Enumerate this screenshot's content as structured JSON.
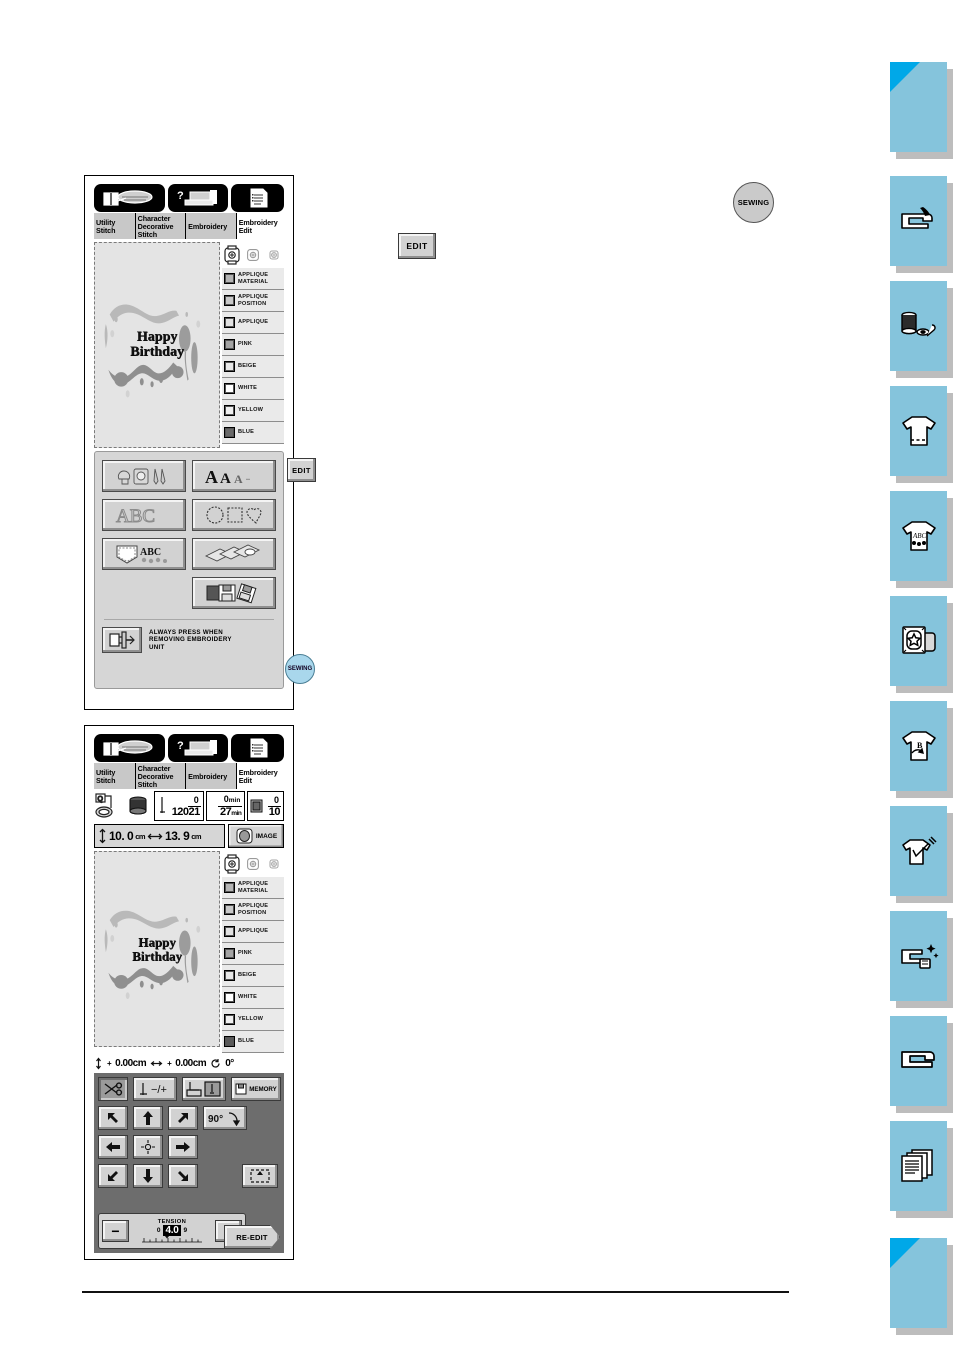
{
  "machine_ui": {
    "top_tabs": [
      {
        "name": "manual-book-icon",
        "label": ""
      },
      {
        "name": "help-machine-icon",
        "label": ""
      },
      {
        "name": "settings-list-icon",
        "label": ""
      }
    ],
    "mode_tabs": [
      {
        "id": "utility",
        "label": "Utility Stitch",
        "line1": "Utility",
        "line2": "Stitch",
        "active": false
      },
      {
        "id": "character",
        "label": "Character Decorative Stitch",
        "line1": "Character",
        "line2": "Decorative",
        "line3": "Stitch",
        "active": false
      },
      {
        "id": "embroidery",
        "label": "Embroidery",
        "line1": "Embroidery",
        "active": false
      },
      {
        "id": "embroidery_edit",
        "label": "Embroidery Edit",
        "line1": "Embroidery",
        "line2": "Edit",
        "active": true
      }
    ]
  },
  "screen1": {
    "design": {
      "text_line1": "Happy",
      "text_line2": "Birthday"
    },
    "hoop_buttons": [
      "hoop-large",
      "hoop-medium",
      "hoop-small"
    ],
    "color_list": [
      {
        "label": "APPLIQUE MATERIAL",
        "line1": "APPLIQUE",
        "line2": "MATERIAL",
        "swatch": "#b4b4b4"
      },
      {
        "label": "APPLIQUE POSITION",
        "line1": "APPLIQUE",
        "line2": "POSITION",
        "swatch": "#c9c9c9"
      },
      {
        "label": "APPLIQUE",
        "line1": "APPLIQUE",
        "line2": "",
        "swatch": "#e2e2e2"
      },
      {
        "label": "PINK",
        "line1": "PINK",
        "line2": "",
        "swatch": "#a3a3a3"
      },
      {
        "label": "BEIGE",
        "line1": "BEIGE",
        "line2": "",
        "swatch": "#e8e8e8"
      },
      {
        "label": "WHITE",
        "line1": "WHITE",
        "line2": "",
        "swatch": "#ffffff"
      },
      {
        "label": "YELLOW",
        "line1": "YELLOW",
        "line2": "",
        "swatch": "#f0f0f0"
      },
      {
        "label": "BLUE",
        "line1": "BLUE",
        "line2": "",
        "swatch": "#6a6a6a"
      }
    ],
    "selection_buttons": [
      {
        "name": "embroidery-patterns-button",
        "icon": "flower-frame-scissors-icon"
      },
      {
        "name": "alphabet-sizes-button",
        "icon": "AAA-letters-icon"
      },
      {
        "name": "abc-font-button",
        "icon": "ABC-outline-icon"
      },
      {
        "name": "frame-shapes-button",
        "icon": "circle-square-heart-icon"
      },
      {
        "name": "pocket-monogram-button",
        "icon": "pocket-ABC-icon"
      },
      {
        "name": "card-designs-button",
        "icon": "embroidery-cards-icon"
      },
      {
        "name": "memory-card-button",
        "icon": "floppy-disk-card-icon"
      }
    ],
    "footer_note": {
      "line1": "ALWAYS PRESS WHEN",
      "line2": "REMOVING EMBROIDERY",
      "line3": "UNIT"
    },
    "edit_button_label": "EDIT",
    "sewing_button_label": "SEWING"
  },
  "screen2": {
    "stats": {
      "presser_foot_icon": "embroidery-foot-icon",
      "bobbin_icon": "bobbin-icon",
      "stitch_count_current": "0",
      "stitch_count_total": "12021",
      "time_elapsed": "0",
      "time_elapsed_unit": "min",
      "time_total": "27",
      "time_total_unit": "min",
      "color_current": "0",
      "color_total": "10"
    },
    "size": {
      "height_value": "10. 0",
      "height_unit": "cm",
      "width_value": "13. 9",
      "width_unit": "cm",
      "image_button_label": "IMAGE"
    },
    "design": {
      "text_line1": "Happy",
      "text_line2": "Birthday"
    },
    "color_list": [
      {
        "label": "APPLIQUE MATERIAL",
        "line1": "APPLIQUE",
        "line2": "MATERIAL",
        "swatch": "#b4b4b4"
      },
      {
        "label": "APPLIQUE POSITION",
        "line1": "APPLIQUE",
        "line2": "POSITION",
        "swatch": "#c9c9c9"
      },
      {
        "label": "APPLIQUE",
        "line1": "APPLIQUE",
        "line2": "",
        "swatch": "#e2e2e2"
      },
      {
        "label": "PINK",
        "line1": "PINK",
        "line2": "",
        "swatch": "#a3a3a3"
      },
      {
        "label": "BEIGE",
        "line1": "BEIGE",
        "line2": "",
        "swatch": "#e8e8e8"
      },
      {
        "label": "WHITE",
        "line1": "WHITE",
        "line2": "",
        "swatch": "#ffffff"
      },
      {
        "label": "YELLOW",
        "line1": "YELLOW",
        "line2": "",
        "swatch": "#f0f0f0"
      },
      {
        "label": "BLUE",
        "line1": "BLUE",
        "line2": "",
        "swatch": "#5a5a5a"
      }
    ],
    "offsets": {
      "vertical_value": "0.00cm",
      "horizontal_value": "0.00cm",
      "rotation_value": "0°"
    },
    "controls": {
      "thread_cut_button": "scissors-icon",
      "needle_updown_button": "needle-plus-minus-icon",
      "start_point_button": "start-point-icon",
      "memory_button_label": "MEMORY",
      "rotate_button_label": "90°",
      "trial_button": "trial-frame-icon",
      "arrows": [
        "up-left",
        "up",
        "up-right",
        "left",
        "center",
        "right",
        "down-left",
        "down",
        "down-right"
      ]
    },
    "tension": {
      "label": "TENSION",
      "value": "4.0",
      "min": "0",
      "max": "9",
      "minus": "−",
      "plus": "+"
    },
    "reedit_button_label": "RE-EDIT"
  },
  "callouts": {
    "edit_label": "EDIT",
    "sewing_label": "SEWING"
  },
  "sidebar": {
    "accent_color": "#85c4dc",
    "corner_color": "#00a8e8",
    "items": [
      {
        "name": "sidebar-tab-cover",
        "icon": "blank-corner-icon"
      },
      {
        "name": "sidebar-tab-machine-overview",
        "icon": "sewing-machine-icon"
      },
      {
        "name": "sidebar-tab-thread-accessories",
        "icon": "thread-spool-bobbin-icon"
      },
      {
        "name": "sidebar-tab-utility-stitches",
        "icon": "tshirt-hem-icon"
      },
      {
        "name": "sidebar-tab-decorative-stitches",
        "icon": "tshirt-abc-icon"
      },
      {
        "name": "sidebar-tab-embroidery",
        "icon": "framed-star-icon"
      },
      {
        "name": "sidebar-tab-embroidery-edit",
        "icon": "tshirt-letter-b-icon"
      },
      {
        "name": "sidebar-tab-appliques",
        "icon": "tshirt-needle-icon"
      },
      {
        "name": "sidebar-tab-maintenance",
        "icon": "machine-cleaning-icon"
      },
      {
        "name": "sidebar-tab-troubleshooting",
        "icon": "machine-side-icon"
      },
      {
        "name": "sidebar-tab-index",
        "icon": "documents-stack-icon"
      },
      {
        "name": "sidebar-tab-back-cover",
        "icon": "blank-corner-icon"
      }
    ]
  }
}
